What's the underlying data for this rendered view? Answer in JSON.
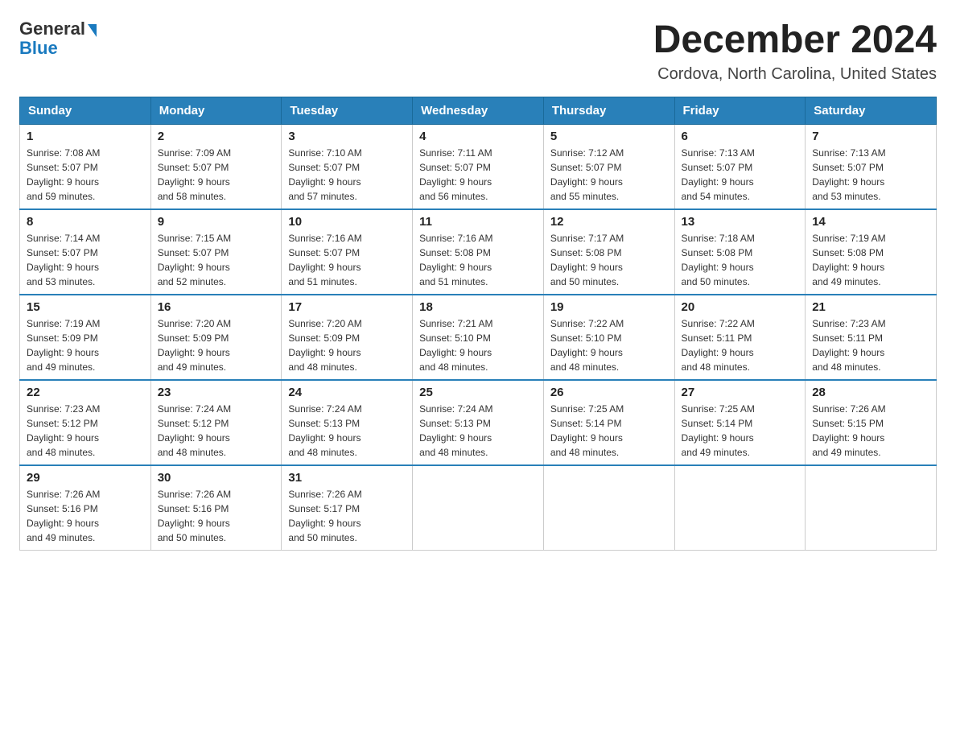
{
  "header": {
    "logo_general": "General",
    "logo_blue": "Blue",
    "month_title": "December 2024",
    "location": "Cordova, North Carolina, United States"
  },
  "weekdays": [
    "Sunday",
    "Monday",
    "Tuesday",
    "Wednesday",
    "Thursday",
    "Friday",
    "Saturday"
  ],
  "weeks": [
    [
      {
        "day": "1",
        "sunrise": "7:08 AM",
        "sunset": "5:07 PM",
        "daylight": "9 hours and 59 minutes."
      },
      {
        "day": "2",
        "sunrise": "7:09 AM",
        "sunset": "5:07 PM",
        "daylight": "9 hours and 58 minutes."
      },
      {
        "day": "3",
        "sunrise": "7:10 AM",
        "sunset": "5:07 PM",
        "daylight": "9 hours and 57 minutes."
      },
      {
        "day": "4",
        "sunrise": "7:11 AM",
        "sunset": "5:07 PM",
        "daylight": "9 hours and 56 minutes."
      },
      {
        "day": "5",
        "sunrise": "7:12 AM",
        "sunset": "5:07 PM",
        "daylight": "9 hours and 55 minutes."
      },
      {
        "day": "6",
        "sunrise": "7:13 AM",
        "sunset": "5:07 PM",
        "daylight": "9 hours and 54 minutes."
      },
      {
        "day": "7",
        "sunrise": "7:13 AM",
        "sunset": "5:07 PM",
        "daylight": "9 hours and 53 minutes."
      }
    ],
    [
      {
        "day": "8",
        "sunrise": "7:14 AM",
        "sunset": "5:07 PM",
        "daylight": "9 hours and 53 minutes."
      },
      {
        "day": "9",
        "sunrise": "7:15 AM",
        "sunset": "5:07 PM",
        "daylight": "9 hours and 52 minutes."
      },
      {
        "day": "10",
        "sunrise": "7:16 AM",
        "sunset": "5:07 PM",
        "daylight": "9 hours and 51 minutes."
      },
      {
        "day": "11",
        "sunrise": "7:16 AM",
        "sunset": "5:08 PM",
        "daylight": "9 hours and 51 minutes."
      },
      {
        "day": "12",
        "sunrise": "7:17 AM",
        "sunset": "5:08 PM",
        "daylight": "9 hours and 50 minutes."
      },
      {
        "day": "13",
        "sunrise": "7:18 AM",
        "sunset": "5:08 PM",
        "daylight": "9 hours and 50 minutes."
      },
      {
        "day": "14",
        "sunrise": "7:19 AM",
        "sunset": "5:08 PM",
        "daylight": "9 hours and 49 minutes."
      }
    ],
    [
      {
        "day": "15",
        "sunrise": "7:19 AM",
        "sunset": "5:09 PM",
        "daylight": "9 hours and 49 minutes."
      },
      {
        "day": "16",
        "sunrise": "7:20 AM",
        "sunset": "5:09 PM",
        "daylight": "9 hours and 49 minutes."
      },
      {
        "day": "17",
        "sunrise": "7:20 AM",
        "sunset": "5:09 PM",
        "daylight": "9 hours and 48 minutes."
      },
      {
        "day": "18",
        "sunrise": "7:21 AM",
        "sunset": "5:10 PM",
        "daylight": "9 hours and 48 minutes."
      },
      {
        "day": "19",
        "sunrise": "7:22 AM",
        "sunset": "5:10 PM",
        "daylight": "9 hours and 48 minutes."
      },
      {
        "day": "20",
        "sunrise": "7:22 AM",
        "sunset": "5:11 PM",
        "daylight": "9 hours and 48 minutes."
      },
      {
        "day": "21",
        "sunrise": "7:23 AM",
        "sunset": "5:11 PM",
        "daylight": "9 hours and 48 minutes."
      }
    ],
    [
      {
        "day": "22",
        "sunrise": "7:23 AM",
        "sunset": "5:12 PM",
        "daylight": "9 hours and 48 minutes."
      },
      {
        "day": "23",
        "sunrise": "7:24 AM",
        "sunset": "5:12 PM",
        "daylight": "9 hours and 48 minutes."
      },
      {
        "day": "24",
        "sunrise": "7:24 AM",
        "sunset": "5:13 PM",
        "daylight": "9 hours and 48 minutes."
      },
      {
        "day": "25",
        "sunrise": "7:24 AM",
        "sunset": "5:13 PM",
        "daylight": "9 hours and 48 minutes."
      },
      {
        "day": "26",
        "sunrise": "7:25 AM",
        "sunset": "5:14 PM",
        "daylight": "9 hours and 48 minutes."
      },
      {
        "day": "27",
        "sunrise": "7:25 AM",
        "sunset": "5:14 PM",
        "daylight": "9 hours and 49 minutes."
      },
      {
        "day": "28",
        "sunrise": "7:26 AM",
        "sunset": "5:15 PM",
        "daylight": "9 hours and 49 minutes."
      }
    ],
    [
      {
        "day": "29",
        "sunrise": "7:26 AM",
        "sunset": "5:16 PM",
        "daylight": "9 hours and 49 minutes."
      },
      {
        "day": "30",
        "sunrise": "7:26 AM",
        "sunset": "5:16 PM",
        "daylight": "9 hours and 50 minutes."
      },
      {
        "day": "31",
        "sunrise": "7:26 AM",
        "sunset": "5:17 PM",
        "daylight": "9 hours and 50 minutes."
      },
      null,
      null,
      null,
      null
    ]
  ],
  "labels": {
    "sunrise": "Sunrise:",
    "sunset": "Sunset:",
    "daylight": "Daylight: 9 hours"
  }
}
